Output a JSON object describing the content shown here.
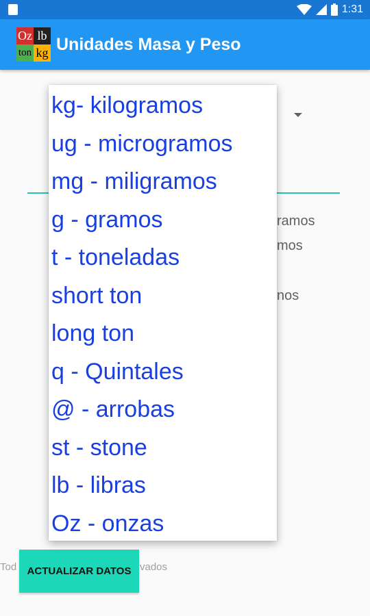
{
  "status_bar": {
    "time": "1:31"
  },
  "app_bar": {
    "title": "Unidades Masa y Peso",
    "logo": {
      "top_left": "Oz",
      "top_right": "lb",
      "bottom_left": "ton",
      "bottom_right": "kg"
    }
  },
  "background": {
    "lines": [
      "ramos",
      "mos",
      "nos"
    ],
    "footer_start": "Tod",
    "footer_end": "vados"
  },
  "dropdown": {
    "options": [
      "kg- kilogramos",
      "ug - microgramos",
      "mg - miligramos",
      "g - gramos",
      "t - toneladas",
      "short ton",
      "long ton",
      "q - Quintales",
      "@ - arrobas",
      "st - stone",
      "lb - libras",
      "Oz - onzas"
    ]
  },
  "button": {
    "label": "ACTUALIZAR DATOS"
  },
  "colors": {
    "primary": "#2196f3",
    "primary_dark": "#1976d2",
    "accent": "#1dd8b8",
    "option_text": "#1a3fe0"
  }
}
